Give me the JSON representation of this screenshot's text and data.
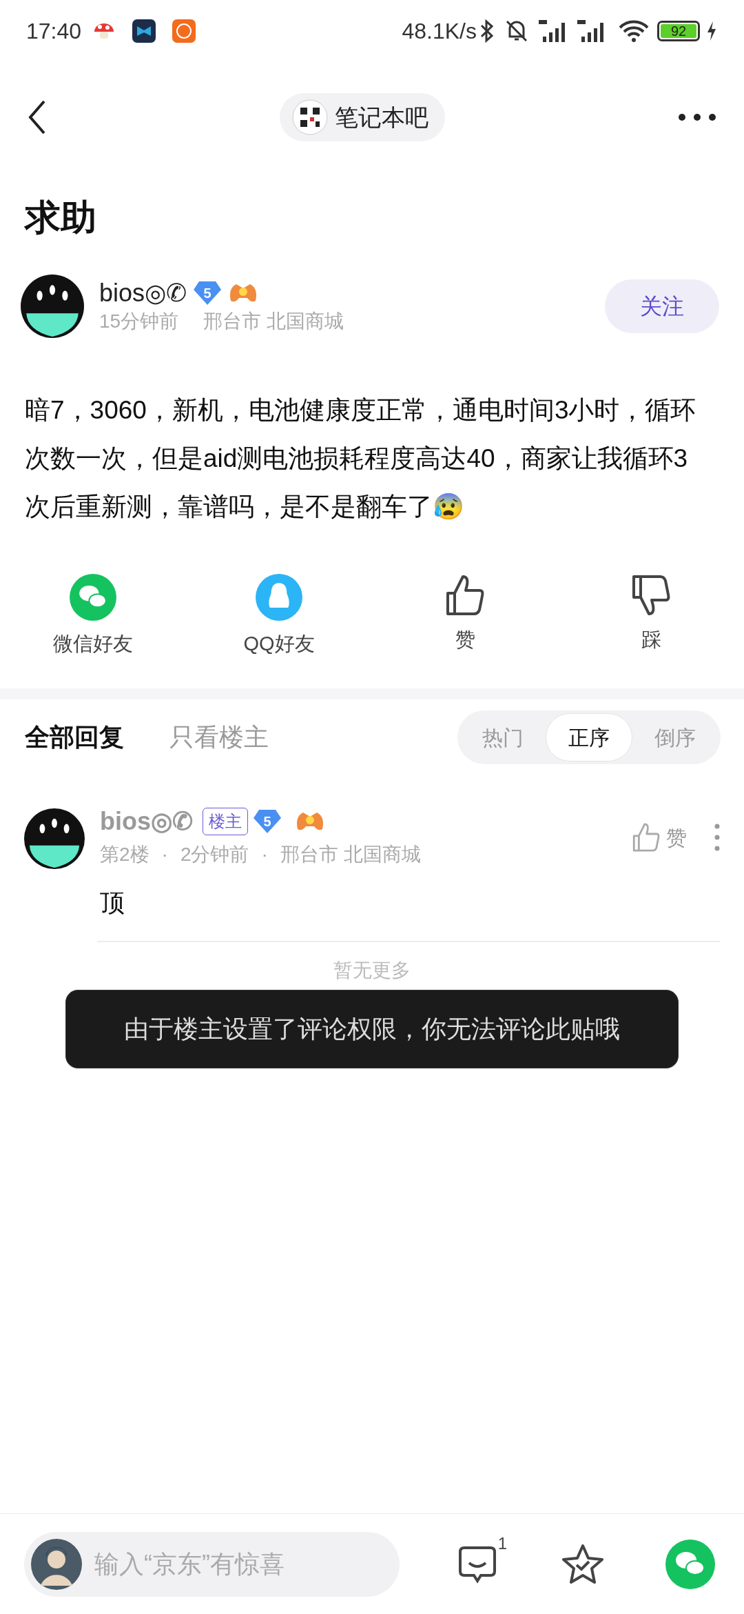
{
  "status_bar": {
    "time": "17:40",
    "network_speed": "48.1K/s",
    "battery": "92"
  },
  "header": {
    "forum_name": "笔记本吧"
  },
  "post": {
    "title": "求助",
    "author": {
      "name": "bios◎✆",
      "level": "5",
      "time": "15分钟前",
      "location": "邢台市 北国商城"
    },
    "follow_label": "关注",
    "content": "暗7，3060，新机，电池健康度正常，通电时间3小时，循环次数一次，但是aid测电池损耗程度高达40，商家让我循环3次后重新测，靠谱吗，是不是翻车了😰",
    "share_actions": [
      {
        "kind": "wechat",
        "label": "微信好友"
      },
      {
        "kind": "qq",
        "label": "QQ好友"
      },
      {
        "kind": "like",
        "label": "赞"
      },
      {
        "kind": "dislike",
        "label": "踩"
      }
    ]
  },
  "reply_tabs": [
    {
      "label": "全部回复",
      "selected": true
    },
    {
      "label": "只看楼主",
      "selected": false
    }
  ],
  "sort_options": [
    {
      "label": "热门",
      "selected": false
    },
    {
      "label": "正序",
      "selected": true
    },
    {
      "label": "倒序",
      "selected": false
    }
  ],
  "replies": [
    {
      "name": "bios◎✆",
      "op_badge": "楼主",
      "level": "5",
      "floor": "第2楼",
      "separator": "·",
      "time": "2分钟前",
      "location": "邢台市 北国商城",
      "like_label": "赞",
      "content": "顶"
    }
  ],
  "end_note": "暂无更多",
  "toast": "由于楼主设置了评论权限，你无法评论此贴哦",
  "bottom_bar": {
    "placeholder": "输入“京东”有惊喜",
    "comment_count": "1"
  }
}
